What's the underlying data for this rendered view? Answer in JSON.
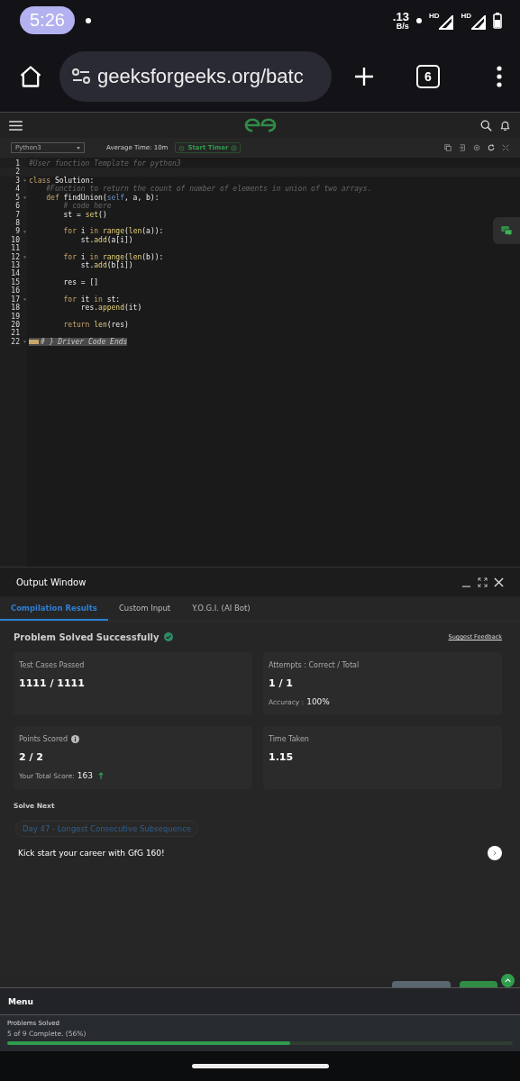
{
  "status_bar": {
    "time": "5:26",
    "net_speed": ".13",
    "net_unit": "B/s",
    "signal_labels": [
      "HD",
      "HD"
    ]
  },
  "browser": {
    "url": "geeksforgeeks.org/batc",
    "tab_count": "6"
  },
  "toolbar": {
    "language": "Python3",
    "average_time": "Average Time: 10m",
    "timer_button": "Start Timer"
  },
  "editor": {
    "lines": [
      {
        "number": "1",
        "fold": false,
        "tokens": [
          {
            "kind": "comment",
            "text": "#User function Template for python3"
          }
        ]
      },
      {
        "number": "2",
        "fold": false
      },
      {
        "number": "3",
        "fold": true,
        "tokens": [
          {
            "kind": "keyword",
            "text": "class"
          },
          {
            "kind": "plain",
            "text": " Solution:"
          }
        ]
      },
      {
        "number": "4",
        "fold": false,
        "tokens": [
          {
            "kind": "comment",
            "text": "    #Function to return the count of number of elements in union of two arrays."
          }
        ]
      },
      {
        "number": "5",
        "fold": true,
        "tokens": [
          {
            "kind": "keyword",
            "text": "    def"
          },
          {
            "kind": "plain",
            "text": " findUnion("
          },
          {
            "kind": "self",
            "text": "self"
          },
          {
            "kind": "plain",
            "text": ", a, b):"
          }
        ]
      },
      {
        "number": "6",
        "fold": false,
        "tokens": [
          {
            "kind": "comment",
            "text": "        # code here"
          }
        ]
      },
      {
        "number": "7",
        "fold": false,
        "tokens": [
          {
            "kind": "plain",
            "text": "        st = "
          },
          {
            "kind": "builtin",
            "text": "set"
          },
          {
            "kind": "plain",
            "text": "()"
          }
        ]
      },
      {
        "number": "8",
        "fold": false
      },
      {
        "number": "9",
        "fold": true,
        "tokens": [
          {
            "kind": "keyword",
            "text": "        for"
          },
          {
            "kind": "plain",
            "text": " i "
          },
          {
            "kind": "keyword",
            "text": "in"
          },
          {
            "kind": "builtin",
            "text": " range"
          },
          {
            "kind": "plain",
            "text": "("
          },
          {
            "kind": "builtin",
            "text": "len"
          },
          {
            "kind": "plain",
            "text": "(a)):"
          }
        ]
      },
      {
        "number": "10",
        "fold": false,
        "tokens": [
          {
            "kind": "plain",
            "text": "            st."
          },
          {
            "kind": "builtin",
            "text": "add"
          },
          {
            "kind": "plain",
            "text": "(a[i])"
          }
        ]
      },
      {
        "number": "11",
        "fold": false
      },
      {
        "number": "12",
        "fold": true,
        "tokens": [
          {
            "kind": "keyword",
            "text": "        for"
          },
          {
            "kind": "plain",
            "text": " i "
          },
          {
            "kind": "keyword",
            "text": "in"
          },
          {
            "kind": "builtin",
            "text": " range"
          },
          {
            "kind": "plain",
            "text": "("
          },
          {
            "kind": "builtin",
            "text": "len"
          },
          {
            "kind": "plain",
            "text": "(b)):"
          }
        ]
      },
      {
        "number": "13",
        "fold": false,
        "tokens": [
          {
            "kind": "plain",
            "text": "            st."
          },
          {
            "kind": "builtin",
            "text": "add"
          },
          {
            "kind": "plain",
            "text": "(b[i])"
          }
        ]
      },
      {
        "number": "14",
        "fold": false
      },
      {
        "number": "15",
        "fold": false,
        "tokens": [
          {
            "kind": "plain",
            "text": "        res = []"
          }
        ]
      },
      {
        "number": "16",
        "fold": false
      },
      {
        "number": "17",
        "fold": true,
        "tokens": [
          {
            "kind": "keyword",
            "text": "        for"
          },
          {
            "kind": "plain",
            "text": " it "
          },
          {
            "kind": "keyword",
            "text": "in"
          },
          {
            "kind": "plain",
            "text": " st:"
          }
        ]
      },
      {
        "number": "18",
        "fold": false,
        "tokens": [
          {
            "kind": "plain",
            "text": "            res."
          },
          {
            "kind": "builtin",
            "text": "append"
          },
          {
            "kind": "plain",
            "text": "(it)"
          }
        ]
      },
      {
        "number": "19",
        "fold": false
      },
      {
        "number": "20",
        "fold": false,
        "tokens": [
          {
            "kind": "keyword",
            "text": "        return"
          },
          {
            "kind": "builtin",
            "text": " len"
          },
          {
            "kind": "plain",
            "text": "(res)"
          }
        ]
      },
      {
        "number": "21",
        "fold": false
      },
      {
        "number": "22",
        "fold": true,
        "tokens": [
          {
            "kind": "folded",
            "text": "# } Driver Code Ends"
          }
        ]
      }
    ]
  },
  "output_window": {
    "title": "Output Window",
    "tabs": [
      {
        "label": "Compilation Results",
        "selected": true
      },
      {
        "label": "Custom Input",
        "selected": false
      },
      {
        "label": "Y.O.G.I. (AI Bot)",
        "selected": false
      }
    ],
    "result": "Problem Solved Successfully",
    "feedback_link": "Suggest Feedback",
    "cards": [
      {
        "label": "Test Cases Passed",
        "value": "1111 / 1111"
      },
      {
        "label": "Attempts : Correct / Total",
        "value": "1 / 1",
        "extra_label": "Accuracy :",
        "extra_value": "100%"
      },
      {
        "label": "Points Scored",
        "info": true,
        "value": "2 / 2",
        "extra_label": "Your Total Score:",
        "extra_value": "163",
        "trend_up": true
      },
      {
        "label": "Time Taken",
        "value": "1.15"
      }
    ],
    "solve_next_heading": "Solve Next",
    "next_problem": "Day 47 - Longest Consecutive Subsequence",
    "promo": "Kick start your career with GfG 160!"
  },
  "menu": {
    "title": "Menu",
    "progress_label": "Problems Solved",
    "progress_text": "5 of 9 Complete. (56%)",
    "level": 0.56
  }
}
